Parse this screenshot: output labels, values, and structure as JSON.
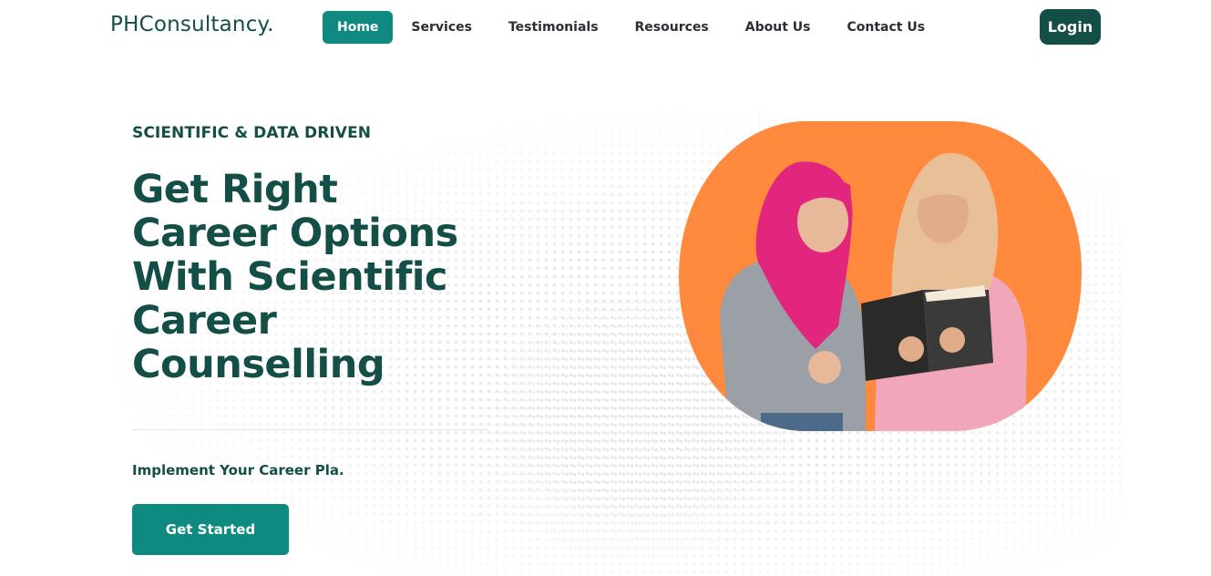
{
  "brand": {
    "name": "PHConsultancy."
  },
  "nav": {
    "items": [
      {
        "label": "Home",
        "active": true
      },
      {
        "label": "Services",
        "active": false
      },
      {
        "label": "Testimonials",
        "active": false
      },
      {
        "label": "Resources",
        "active": false
      },
      {
        "label": "About Us",
        "active": false
      },
      {
        "label": "Contact Us",
        "active": false
      }
    ],
    "login_label": "Login"
  },
  "hero": {
    "eyebrow": "SCIENTIFIC & DATA DRIVEN",
    "headline_lines": [
      "Get Right",
      "Career Options",
      "With Scientific",
      "Career",
      "Counselling"
    ],
    "subtitle": "Implement Your Career Pla.",
    "cta_label": "Get Started",
    "image": "two-students-reading-book-photo"
  },
  "colors": {
    "brand_dark": "#134e47",
    "brand_teal": "#0f8a80",
    "hero_orange": "#ff8a3d"
  }
}
